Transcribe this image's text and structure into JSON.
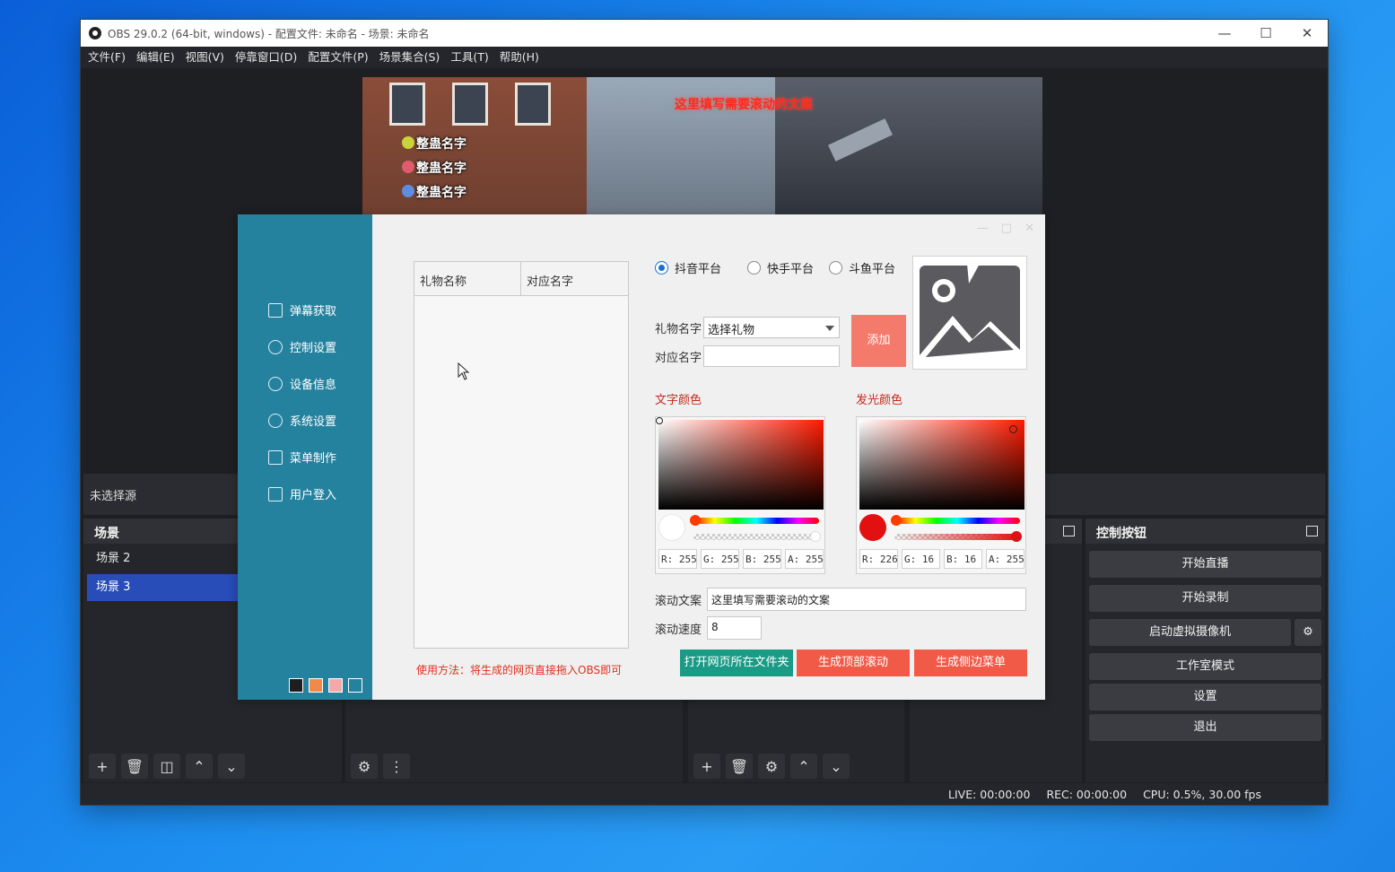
{
  "obs": {
    "title": "OBS 29.0.2 (64-bit, windows) - 配置文件: 未命名 - 场景: 未命名",
    "menu": [
      "文件(F)",
      "编辑(E)",
      "视图(V)",
      "停靠窗口(D)",
      "配置文件(P)",
      "场景集合(S)",
      "工具(T)",
      "帮助(H)"
    ],
    "preview": {
      "scroll_text": "这里填写需要滚动的文案",
      "gift_rows": [
        "整蛊名字",
        "整蛊名字",
        "整蛊名字"
      ]
    },
    "no_source": "未选择源",
    "scenes": {
      "title": "场景",
      "items": [
        "场景 2",
        "场景 3"
      ]
    },
    "controls": {
      "title": "控制按钮",
      "buttons": [
        "开始直播",
        "开始录制",
        "启动虚拟摄像机",
        "工作室模式",
        "设置",
        "退出"
      ]
    },
    "status": {
      "live": "LIVE: 00:00:00",
      "rec": "REC: 00:00:00",
      "cpu": "CPU: 0.5%, 30.00 fps"
    }
  },
  "plugin": {
    "nav": [
      "弹幕获取",
      "控制设置",
      "设备信息",
      "系统设置",
      "菜单制作",
      "用户登入"
    ],
    "swatch_colors": [
      "#1e1e1e",
      "#f08a4b",
      "#f4a9a8",
      "#25829f"
    ],
    "table": {
      "col1": "礼物名称",
      "col2": "对应名字"
    },
    "usage": "使用方法：将生成的网页直接拖入OBS即可",
    "platforms": [
      {
        "label": "抖音平台",
        "selected": true
      },
      {
        "label": "快手平台",
        "selected": false
      },
      {
        "label": "斗鱼平台",
        "selected": false
      }
    ],
    "gift_name_label": "礼物名字",
    "gift_select": "选择礼物",
    "mapped_name_label": "对应名字",
    "add_button": "添加",
    "text_color": {
      "title": "文字颜色",
      "hex": "#ffffff",
      "r": "R: 255",
      "g": "G: 255",
      "b": "B: 255",
      "a": "A: 255"
    },
    "glow_color": {
      "title": "发光颜色",
      "hex": "#e21010",
      "r": "R: 226",
      "g": "G: 16",
      "b": "B: 16",
      "a": "A: 255"
    },
    "scroll_text_label": "滚动文案",
    "scroll_text_value": "这里填写需要滚动的文案",
    "scroll_speed_label": "滚动速度",
    "scroll_speed_value": "8",
    "buttons": {
      "open_folder": "打开网页所在文件夹",
      "gen_top": "生成顶部滚动",
      "gen_side": "生成侧边菜单"
    },
    "accent_colors": {
      "teal": "#1a9b86",
      "red": "#f25a48",
      "sidebar": "#25829f"
    }
  }
}
